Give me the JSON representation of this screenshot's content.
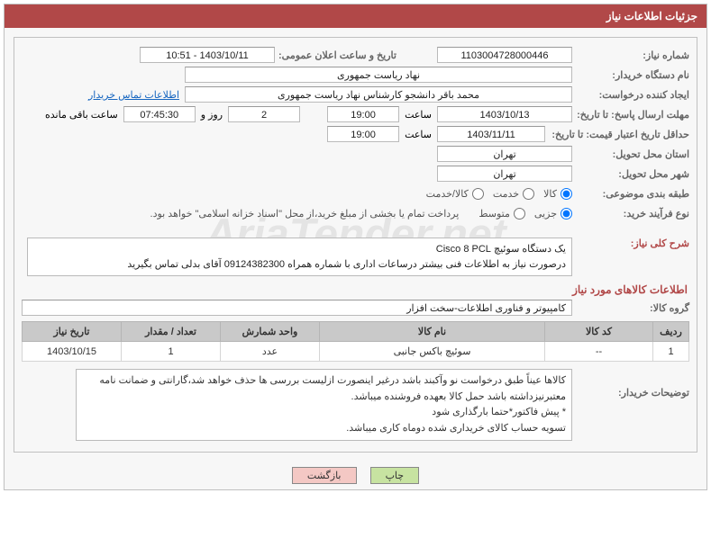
{
  "header": "جزئیات اطلاعات نیاز",
  "watermark": "AriaTender.net",
  "labels": {
    "need_no": "شماره نیاز:",
    "ann_time": "تاریخ و ساعت اعلان عمومی:",
    "buyer_org": "نام دستگاه خریدار:",
    "requester": "ایجاد کننده درخواست:",
    "contact_link": "اطلاعات تماس خریدار",
    "deadline": "مهلت ارسال پاسخ: تا تاریخ:",
    "time_word": "ساعت",
    "day_and": "روز و",
    "remain": "ساعت باقی مانده",
    "validity": "حداقل تاریخ اعتبار قیمت: تا تاریخ:",
    "province": "استان محل تحویل:",
    "city": "شهر محل تحویل:",
    "category": "طبقه بندی موضوعی:",
    "proc_type": "نوع فرآیند خرید:",
    "pay_note": "پرداخت تمام یا بخشی از مبلغ خرید،از محل \"اسناد خزانه اسلامی\" خواهد بود.",
    "summary": "شرح کلی نیاز:",
    "items_title": "اطلاعات کالاهای مورد نیاز",
    "item_group": "گروه کالا:",
    "buyer_notes": "توضیحات خریدار:"
  },
  "values": {
    "need_no": "1103004728000446",
    "ann_time": "1403/10/11 - 10:51",
    "buyer_org": "نهاد ریاست جمهوری",
    "requester": "محمد باقر دانشجو کارشناس نهاد ریاست جمهوری",
    "deadline_date": "1403/10/13",
    "deadline_time": "19:00",
    "remain_days": "2",
    "remain_time": "07:45:30",
    "validity_date": "1403/11/11",
    "validity_time": "19:00",
    "province": "تهران",
    "city": "تهران",
    "summary_l1": "یک دستگاه سوئیچ Cisco 8 PCL",
    "summary_l2": "درصورت نیاز به اطلاعات فنی بیشتر درساعات اداری با شماره همراه 09124382300 آقای بدلی تماس بگیرید",
    "item_group": "کامپیوتر و فناوری اطلاعات-سخت افزار"
  },
  "radios": {
    "cat": [
      {
        "label": "کالا",
        "checked": true
      },
      {
        "label": "خدمت",
        "checked": false
      },
      {
        "label": "کالا/خدمت",
        "checked": false
      }
    ],
    "proc": [
      {
        "label": "جزیی",
        "checked": true
      },
      {
        "label": "متوسط",
        "checked": false
      }
    ]
  },
  "table": {
    "headers": [
      "ردیف",
      "کد کالا",
      "نام کالا",
      "واحد شمارش",
      "تعداد / مقدار",
      "تاریخ نیاز"
    ],
    "row": {
      "n": "1",
      "code": "--",
      "name": "سوئیچ باکس جانبی",
      "unit": "عدد",
      "qty": "1",
      "date": "1403/10/15"
    }
  },
  "buyer_notes": [
    "کالاها عیناً طبق درخواست نو وآکبند باشد درغیر اینصورت ازلیست بررسی ها حذف خواهد شد،گارانتی و ضمانت نامه معتبرنیزداشته باشد حمل کالا بعهده فروشنده میباشد.",
    "* پیش فاکتور*حتما بارگذاری شود",
    "تسویه حساب کالای خریداری شده دوماه کاری میباشد."
  ],
  "buttons": {
    "print": "چاپ",
    "back": "بازگشت"
  }
}
